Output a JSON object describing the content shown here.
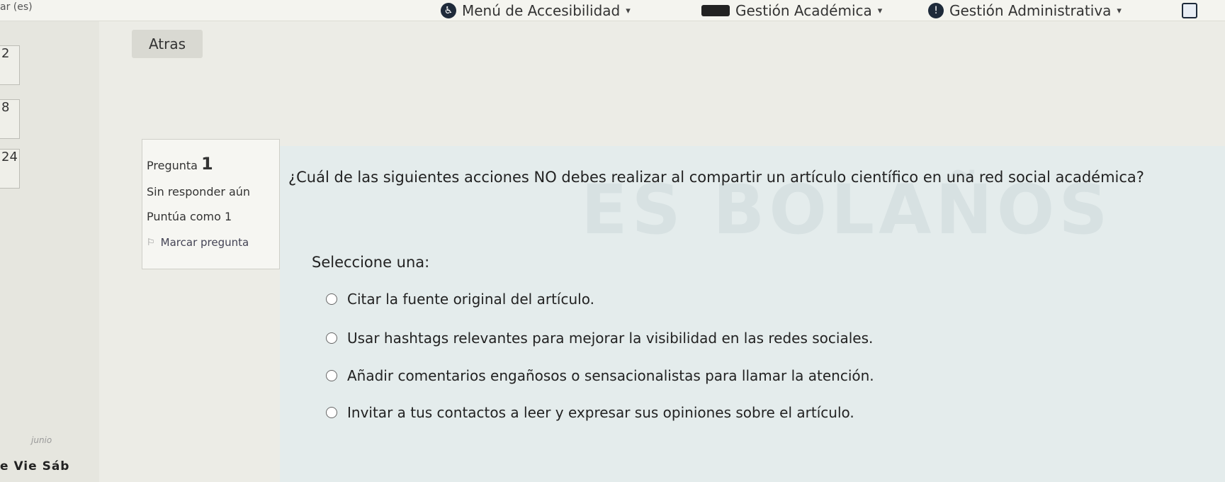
{
  "topbar": {
    "clip_left": "ar (es)",
    "accessibility_menu": "Menú de Accesibilidad",
    "academic_menu": "Gestión Académica",
    "admin_menu": "Gestión Administrativa"
  },
  "calendar": {
    "days": [
      "2",
      "8",
      "24"
    ],
    "month_label": "junio",
    "weekdays": "e  Vie  Sáb"
  },
  "back_button": "Atras",
  "question_info": {
    "label": "Pregunta",
    "number": "1",
    "status": "Sin responder aún",
    "score": "Puntúa como 1",
    "flag_label": "Marcar pregunta"
  },
  "question": {
    "text": "¿Cuál de las siguientes acciones NO debes realizar al compartir un artículo científico en una red social académica?",
    "select_label": "Seleccione una:",
    "options": [
      "Citar la fuente original del artículo.",
      "Usar hashtags relevantes para mejorar la visibilidad en las redes sociales.",
      "Añadir comentarios engañosos o sensacionalistas para llamar la atención.",
      "Invitar a tus contactos a leer y expresar sus opiniones sobre el artículo."
    ]
  },
  "watermark": "ES BOLAÑOS",
  "icons": {
    "accessibility": "accessibility-icon",
    "academic": "graduation-cap-icon",
    "admin": "alert-icon",
    "flag": "flag-icon"
  }
}
